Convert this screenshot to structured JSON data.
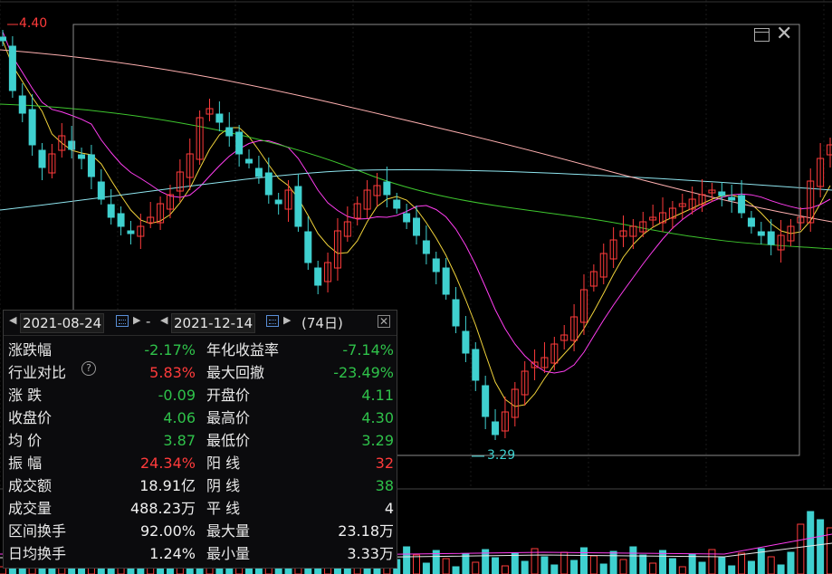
{
  "chart": {
    "price_high_label": "4.40",
    "price_low_label": "3.29",
    "colors": {
      "up": "#ff3b3b",
      "down": "#3fd0cf",
      "ma5": "#e8e8e8",
      "ma10": "#f0d23a",
      "ma20": "#ff3df0",
      "ma30": "#3ec62e",
      "ma60": "#8fe6f0",
      "ma120": "#ffb0b0",
      "selection": "#8a8a8a"
    }
  },
  "panel": {
    "start_date": "2021-08-24",
    "end_date": "2021-12-14",
    "separator": "-",
    "days": "(74日)",
    "rows": [
      {
        "l1": "涨跌幅",
        "v1": "-2.17%",
        "c1": "green",
        "l2": "年化收益率",
        "v2": "-7.14%",
        "c2": "green"
      },
      {
        "l1": "行业对比",
        "v1": "5.83%",
        "c1": "red",
        "l2": "最大回撤",
        "v2": "-23.49%",
        "c2": "green",
        "help": "?"
      },
      {
        "l1": "涨  跌",
        "v1": "-0.09",
        "c1": "green",
        "l2": "开盘价",
        "v2": "4.11",
        "c2": "green"
      },
      {
        "l1": "收盘价",
        "v1": "4.06",
        "c1": "green",
        "l2": "最高价",
        "v2": "4.30",
        "c2": "green"
      },
      {
        "l1": "均  价",
        "v1": "3.87",
        "c1": "green",
        "l2": "最低价",
        "v2": "3.29",
        "c2": "green"
      },
      {
        "l1": "振  幅",
        "v1": "24.34%",
        "c1": "red",
        "l2": "阳  线",
        "v2": "32",
        "c2": "red"
      },
      {
        "l1": "成交额",
        "v1": "18.91亿",
        "c1": "white",
        "l2": "阴  线",
        "v2": "38",
        "c2": "green"
      },
      {
        "l1": "成交量",
        "v1": "488.23万",
        "c1": "white",
        "l2": "平  线",
        "v2": "4",
        "c2": "white"
      },
      {
        "l1": "区间换手",
        "v1": "92.00%",
        "c1": "white",
        "l2": "最大量",
        "v2": "23.18万",
        "c2": "white"
      },
      {
        "l1": "日均换手",
        "v1": "1.24%",
        "c1": "white",
        "l2": "最小量",
        "v2": "3.33万",
        "c2": "white"
      }
    ]
  },
  "icons": [
    "calendar-icon",
    "restore-window-icon",
    "close-icon",
    "help-icon",
    "arrow-left-icon",
    "arrow-right-icon"
  ]
}
